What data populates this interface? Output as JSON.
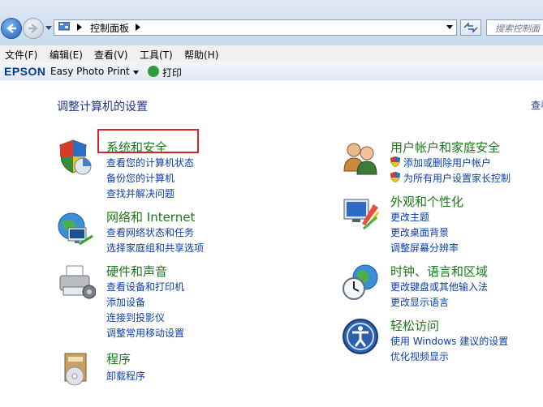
{
  "address_bar": {
    "path_label": "控制面板",
    "search_placeholder": "搜索控制面"
  },
  "menu": [
    "文件(F)",
    "编辑(E)",
    "查看(V)",
    "工具(T)",
    "帮助(H)"
  ],
  "toolbar": {
    "brand": "EPSON",
    "app_name": "Easy Photo Print",
    "print_label": "打印"
  },
  "main": {
    "title": "调整计算机的设置",
    "view_label_cut": "查看"
  },
  "categories": [
    {
      "title": "系统和安全",
      "icon": "shield-icon",
      "links": [
        "查看您的计算机状态",
        "备份您的计算机",
        "查找并解决问题"
      ]
    },
    {
      "title": "网络和 Internet",
      "icon": "network-icon",
      "links": [
        "查看网络状态和任务",
        "选择家庭组和共享选项"
      ]
    },
    {
      "title": "硬件和声音",
      "icon": "printer-icon",
      "links": [
        "查看设备和打印机",
        "添加设备",
        "连接到投影仪",
        "调整常用移动设置"
      ]
    },
    {
      "title": "程序",
      "icon": "programs-icon",
      "links": [
        "卸载程序"
      ]
    },
    {
      "title": "用户帐户和家庭安全",
      "icon": "users-icon",
      "links": [
        "添加或删除用户帐户",
        "为所有用户设置家长控制"
      ]
    },
    {
      "title": "外观和个性化",
      "icon": "appearance-icon",
      "links": [
        "更改主题",
        "更改桌面背景",
        "调整屏幕分辨率"
      ]
    },
    {
      "title": "时钟、语言和区域",
      "icon": "clock-globe-icon",
      "links": [
        "更改键盘或其他输入法",
        "更改显示语言"
      ]
    },
    {
      "title": "轻松访问",
      "icon": "ease-of-access-icon",
      "links": [
        "使用 Windows 建议的设置",
        "优化视频显示"
      ]
    }
  ],
  "colors": {
    "category_title": "#1a7a1a",
    "link": "#0c3fa8",
    "page_title": "#1e3287",
    "highlight": "#d8232a"
  }
}
